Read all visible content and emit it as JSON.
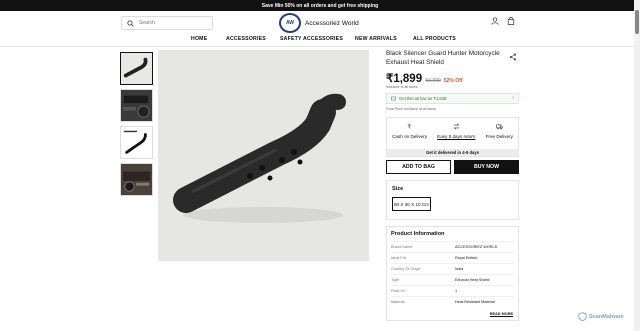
{
  "announcement": "Save Min 50% on all orders and get free shipping",
  "header": {
    "search_placeholder": "Search",
    "logo_badge": "AW",
    "logo_name": "Accessoriez World"
  },
  "nav": [
    "HOME",
    "ACCESSORIES",
    "SAFETY ACCESSORIES",
    "NEW ARRIVALS",
    "ALL PRODUCTS"
  ],
  "product": {
    "title": "Black Silencer Guard Hunter Motorcycle Exhaust Heat Shield",
    "price": "₹1,899",
    "mrp": "₹3,999",
    "discount": "52% Off",
    "tax_note": "Inclusive of all taxes",
    "offer_text": "Get this as low as ₹1,639",
    "final_price_note": "Final Price Inclusive of all taxes",
    "features": [
      "Cash on Delivery",
      "Easy 5 days return",
      "Free Delivery"
    ],
    "delivery_note": "Get it delivered in 4-9 days",
    "add_to_bag": "ADD TO BAG",
    "buy_now": "BUY NOW",
    "size_label": "Size",
    "size_value": "50 X 30 X 10 Cm",
    "info_title": "Product Information",
    "info_rows": [
      {
        "k": "Brand Name",
        "v": "ACCESSORIEZ WORLD"
      },
      {
        "k": "Ideal For",
        "v": "Royal Enfield"
      },
      {
        "k": "Country Of Origin",
        "v": "India"
      },
      {
        "k": "Type",
        "v": "Exhaust Heat Shield"
      },
      {
        "k": "Pack Of",
        "v": "1"
      },
      {
        "k": "Material",
        "v": "Heat-Resistant Material"
      }
    ],
    "read_more": "READ MORE"
  },
  "watermark": "ScanMalware",
  "colors": {
    "accent": "#111111",
    "offer_green": "#2d7a3a",
    "discount": "#e0531f"
  }
}
